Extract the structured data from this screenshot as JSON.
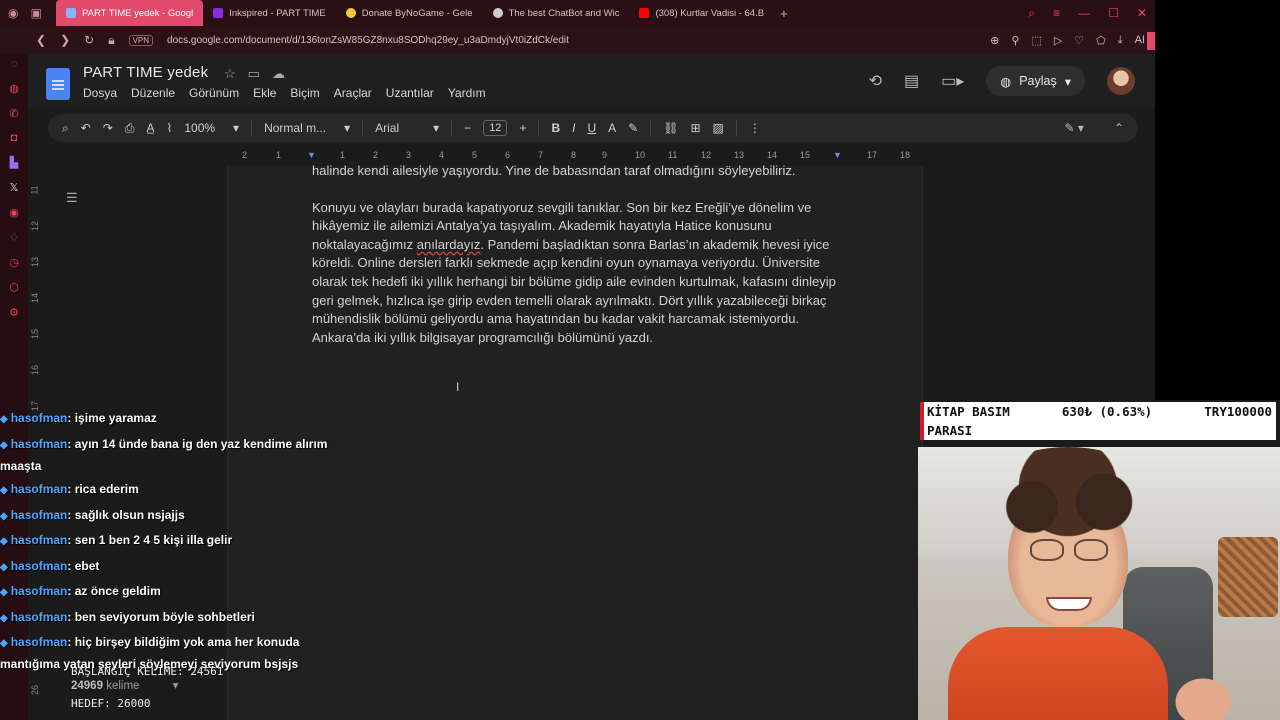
{
  "browser": {
    "tabs": [
      {
        "label": "PART TIME yedek - Googl",
        "active": true,
        "color": "#8ab4f8"
      },
      {
        "label": "Inkspired - PART TIME",
        "active": false,
        "color": "#8a2be2"
      },
      {
        "label": "Donate ByNoGame - Gele",
        "active": false,
        "color": "#f5c542"
      },
      {
        "label": "The best ChatBot and Wic",
        "active": false,
        "color": "#cccccc"
      },
      {
        "label": "(308) Kurtlar Vadisi - 64.B",
        "active": false,
        "color": "#ff0000"
      }
    ],
    "vpn_label": "VPN",
    "url": "docs.google.com/document/d/136tonZsW85GZ8nxu8SODhq29ey_u3aDmdyjVt0iZdCk/edit",
    "ai_label": "AI"
  },
  "docs": {
    "title": "PART TIME  yedek",
    "menu": [
      "Dosya",
      "Düzenle",
      "Görünüm",
      "Ekle",
      "Biçim",
      "Araçlar",
      "Uzantılar",
      "Yardım"
    ],
    "share_label": "Paylaş",
    "toolbar": {
      "zoom": "100%",
      "style": "Normal m...",
      "font": "Arial",
      "font_size": "12"
    },
    "ruler_ticks": [
      "2",
      "1",
      "1",
      "2",
      "3",
      "4",
      "5",
      "6",
      "7",
      "8",
      "9",
      "10",
      "11",
      "12",
      "13",
      "14",
      "15",
      "16",
      "17",
      "18"
    ],
    "vruler_ticks": [
      "11",
      "12",
      "13",
      "14",
      "15",
      "16",
      "17",
      "18",
      "19",
      "20",
      "21",
      "22",
      "23",
      "24",
      "25",
      "26"
    ],
    "paragraph_top": "halinde kendi ailesiyle yaşıyordu. Yine de babasından taraf olmadığını söyleyebiliriz.",
    "paragraph_main_pre": "Konuyu ve olayları burada kapatıyoruz sevgili tanıklar. Son bir kez Ereğli’ye dönelim ve hikâyemiz ile ailemizi Antalya’ya taşıyalım. Akademik hayatıyla Hatice konusunu noktalayacağımız ",
    "paragraph_main_flag": "anılardayız",
    "paragraph_main_post": ". Pandemi başladıktan sonra Barlas’ın akademik hevesi iyice köreldi. Online dersleri farklı sekmede açıp kendini oyun oynamaya veriyordu. Üniversite olarak tek hedefi iki yıllık herhangi bir bölüme gidip aile evinden kurtulmak, kafasını dinleyip geri gelmek, hızlıca işe girip evden temelli olarak ayrılmaktı. Dört yıllık yazabileceği birkaç mühendislik bölümü geliyordu ama hayatından bu kadar vakit harcamak istemiyordu. Ankara’da iki yıllık bilgisayar programcılığı bölümünü yazdı.",
    "word_count_number": "24969",
    "word_count_label": "kelime"
  },
  "chat": {
    "messages": [
      {
        "user": "hasofman",
        "text": ": işime yaramaz"
      },
      {
        "user": "hasofman",
        "text": ": ayın 14 ünde bana ig den yaz kendime alırım maaşta"
      },
      {
        "user": "hasofman",
        "text": ": rica ederim"
      },
      {
        "user": "hasofman",
        "text": ": sağlık olsun nsjajjs"
      },
      {
        "user": "hasofman",
        "text": ": sen 1 ben 2 4 5 kişi illa gelir"
      },
      {
        "user": "hasofman",
        "text": ": ebet"
      },
      {
        "user": "hasofman",
        "text": ": az önce geldim"
      },
      {
        "user": "hasofman",
        "text": ": ben seviyorum böyle sohbetleri"
      },
      {
        "user": "hasofman",
        "text": ": hiç birşey bildiğim yok ama her konuda mantığıma yatan şeyleri söylemeyi seviyorum bsjsjs"
      }
    ]
  },
  "overlay": {
    "start_words": "BAŞLANGIÇ KELİME: 24561",
    "target_words": "HEDEF: 26000",
    "donation_title_1": "KİTAP BASIM",
    "donation_title_2": "PARASI",
    "donation_amount": "630₺ (0.63%)",
    "donation_goal": "TRY100000"
  }
}
